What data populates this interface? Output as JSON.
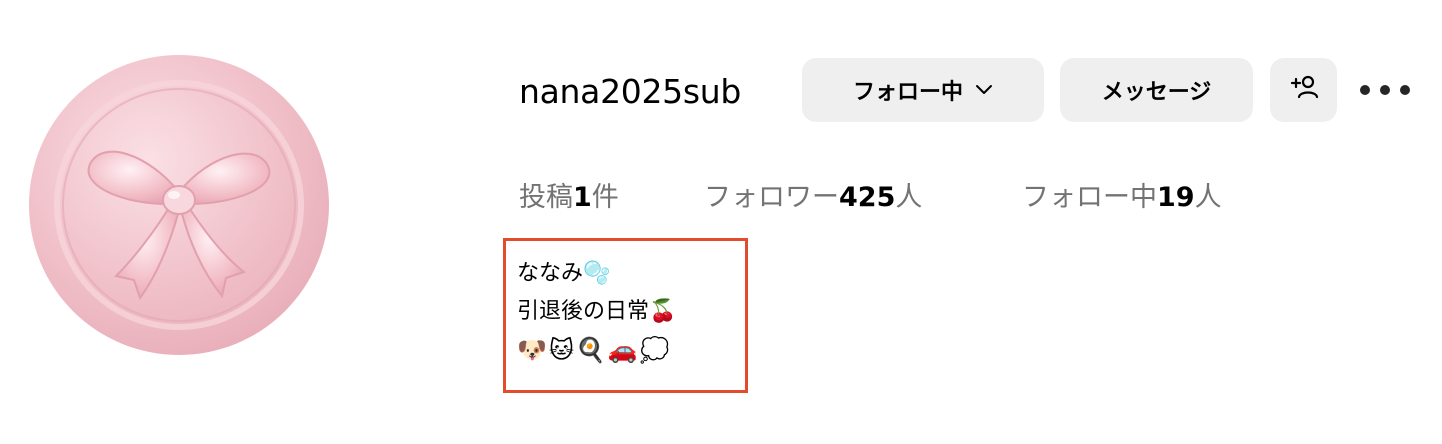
{
  "profile": {
    "username": "nana2025sub",
    "follow_button_label": "フォロー中",
    "message_button_label": "メッセージ",
    "stats": {
      "posts_label": "投稿",
      "posts_count": "1",
      "posts_unit": "件",
      "followers_label": "フォロワー",
      "followers_count": "425",
      "followers_unit": "人",
      "following_label": "フォロー中",
      "following_count": "19",
      "following_unit": "人"
    },
    "bio": {
      "name_line": "ななみ🫧",
      "tagline": "引退後の日常🍒",
      "emoji_line": "🐶🐱🍳🚗💭"
    }
  },
  "icons": {
    "follow_chevron": "chevron-down-icon",
    "add_user": "add-user-icon",
    "more": "more-options-icon",
    "avatar": "pink-ribbon-wax-seal"
  },
  "colors": {
    "button_bg": "#efefef",
    "muted_text": "#737373",
    "highlight_border": "#e24c2c",
    "avatar_pink": "#f3c4cd"
  }
}
